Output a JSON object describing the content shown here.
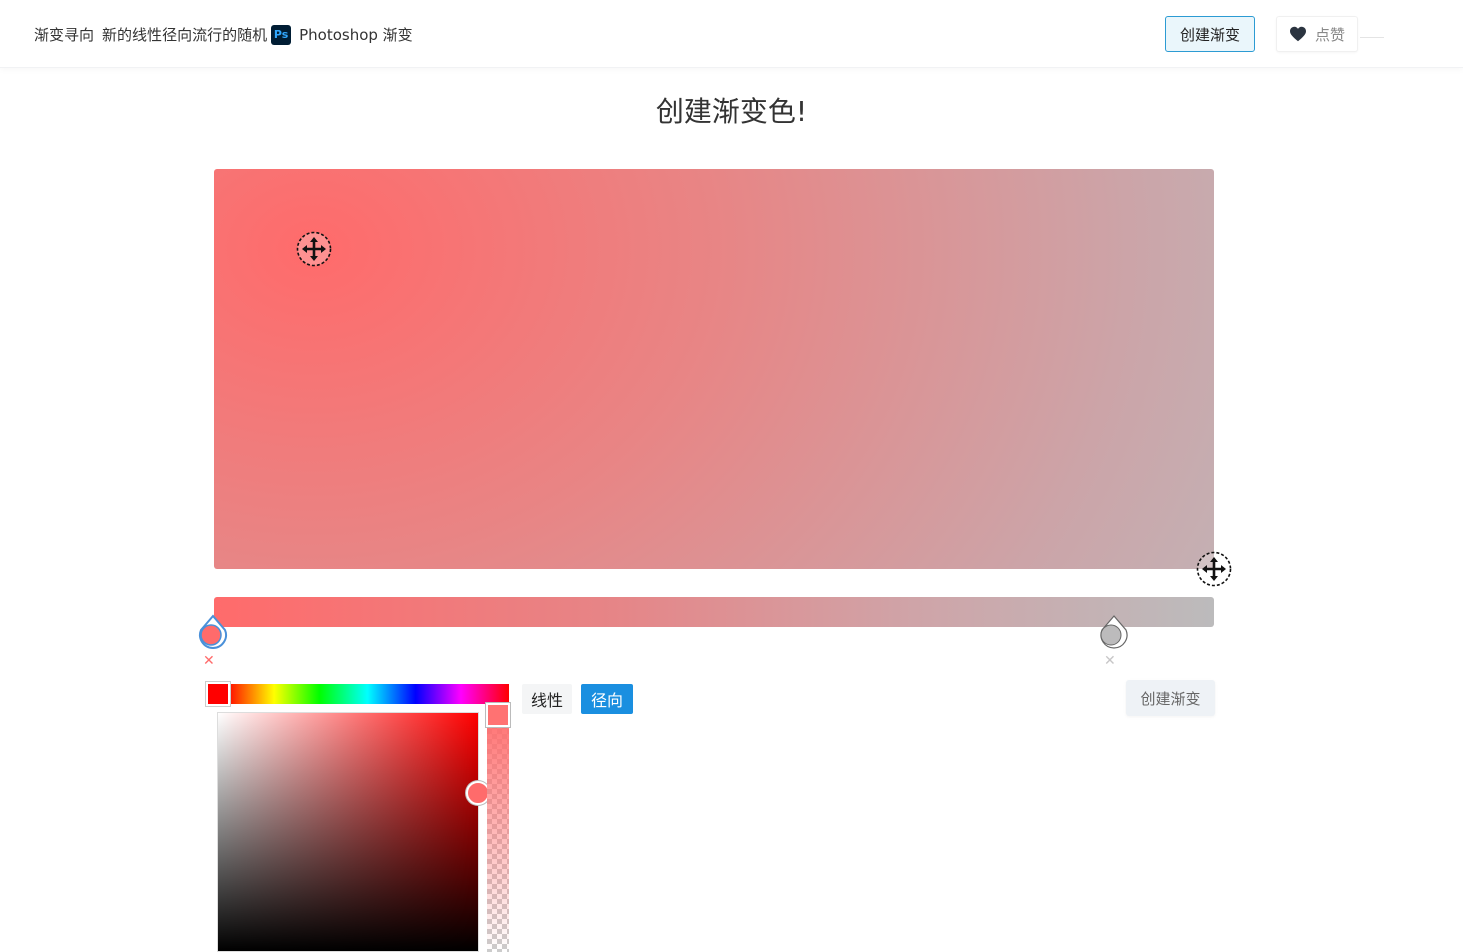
{
  "header": {
    "nav_items": [
      "渐变",
      "寻向",
      "新的",
      "线性",
      "径向",
      "流行的",
      "随机"
    ],
    "ps_icon_label": "Ps",
    "photoshop_link": "Photoshop 渐变",
    "create_button": "创建渐变",
    "like_button": "点赞"
  },
  "main": {
    "title": "创建渐变色!",
    "create_button": "创建渐变"
  },
  "gradient": {
    "type_options": [
      "线性",
      "径向"
    ],
    "selected_type": "径向",
    "stops": [
      {
        "color": "#ff6b6b",
        "position": 0
      },
      {
        "color": "#bcbbbc",
        "position": 90
      }
    ],
    "delete_glyph": "✕"
  },
  "color_picker": {
    "hue_color": "#ff0000",
    "selected_color": "#ff6b6b"
  },
  "colors": {
    "accent": "#1a8fe0",
    "primary_border": "#2c9bd3"
  }
}
